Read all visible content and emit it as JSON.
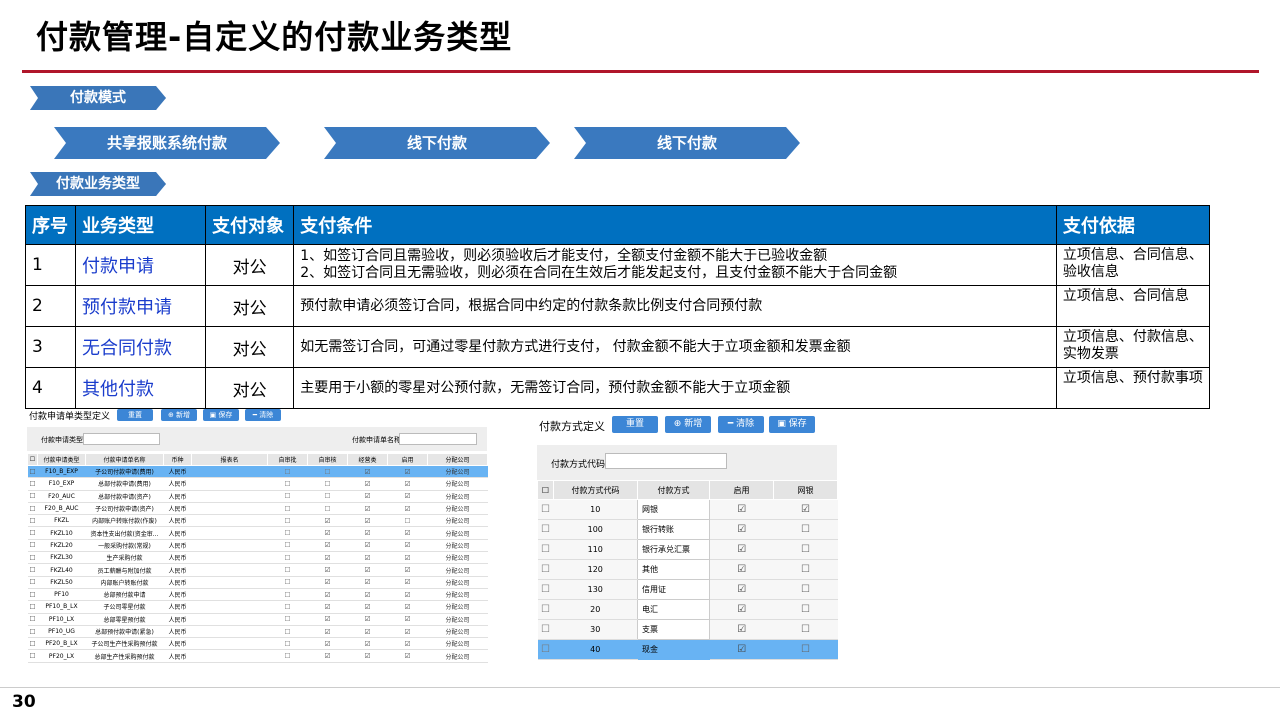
{
  "title": "付款管理-自定义的付款业务类型",
  "tags": {
    "mode": "付款模式",
    "biz_type": "付款业务类型"
  },
  "modes": [
    "共享报账系统付款",
    "线下付款",
    "线下付款"
  ],
  "table": {
    "headers": [
      "序号",
      "业务类型",
      "支付对象",
      "支付条件",
      "支付依据"
    ],
    "rows": [
      {
        "no": "1",
        "type": "付款申请",
        "target": "对公",
        "cond1": "1、如签订合同且需验收，则必须验收后才能支付，全额支付金额不能大于已验收金额",
        "cond2": "2、如签订合同且无需验收，则必须在合同在生效后才能发起支付，且支付金额不能大于合同金额",
        "basis": "立项信息、合同信息、验收信息"
      },
      {
        "no": "2",
        "type": "预付款申请",
        "target": "对公",
        "cond1": "预付款申请必须签订合同，根据合同中约定的付款条款比例支付合同预付款",
        "cond2": "",
        "basis": "立项信息、合同信息"
      },
      {
        "no": "3",
        "type": "无合同付款",
        "target": "对公",
        "cond1": "如无需签订合同，可通过零星付款方式进行支付，  付款金额不能大于立项金额和发票金额",
        "cond2": "",
        "basis": "立项信息、付款信息、实物发票"
      },
      {
        "no": "4",
        "type": "其他付款",
        "target": "对公",
        "cond1": "主要用于小额的零星对公预付款，无需签订合同，预付款金额不能大于立项金额",
        "cond2": "",
        "basis": "立项信息、预付款事项"
      }
    ]
  },
  "panel1": {
    "title": "付款申请单类型定义",
    "buttons": [
      "重置",
      "⊕ 新增",
      "▣ 保存",
      "━ 清除"
    ],
    "form": {
      "type_label": "付款申请类型:",
      "name_label": "付款申请单名称:"
    },
    "headers": [
      "付款申请类型",
      "付款申请单名称",
      "币种",
      "报表名",
      "自审批",
      "自审核",
      "经营类",
      "启用",
      "分配公司"
    ],
    "rows": [
      {
        "code": "F10_B_EXP",
        "name": "子公司付款申请(费用)",
        "cur": "人民币",
        "a": false,
        "b": false,
        "c": true,
        "d": true,
        "co": "分配公司",
        "sel": true
      },
      {
        "code": "F10_EXP",
        "name": "总部付款申请(费用)",
        "cur": "人民币",
        "a": false,
        "b": false,
        "c": true,
        "d": true,
        "co": "分配公司"
      },
      {
        "code": "F20_AUC",
        "name": "总部付款申请(资产)",
        "cur": "人民币",
        "a": false,
        "b": false,
        "c": true,
        "d": true,
        "co": "分配公司"
      },
      {
        "code": "F20_B_AUC",
        "name": "子公司付款申请(资产)",
        "cur": "人民币",
        "a": false,
        "b": false,
        "c": true,
        "d": true,
        "co": "分配公司"
      },
      {
        "code": "FKZL",
        "name": "内部账户转账付款(作废)",
        "cur": "人民币",
        "a": false,
        "b": true,
        "c": true,
        "d": false,
        "co": "分配公司"
      },
      {
        "code": "FKZL10",
        "name": "资本性支出付款(资金审...",
        "cur": "人民币",
        "a": false,
        "b": true,
        "c": true,
        "d": true,
        "co": "分配公司"
      },
      {
        "code": "FKZL20",
        "name": "一般采购付款(常规)",
        "cur": "人民币",
        "a": false,
        "b": true,
        "c": true,
        "d": true,
        "co": "分配公司"
      },
      {
        "code": "FKZL30",
        "name": "生产采购付款",
        "cur": "人民币",
        "a": false,
        "b": true,
        "c": true,
        "d": true,
        "co": "分配公司"
      },
      {
        "code": "FKZL40",
        "name": "员工薪酬与附加付款",
        "cur": "人民币",
        "a": false,
        "b": true,
        "c": true,
        "d": true,
        "co": "分配公司"
      },
      {
        "code": "FKZL50",
        "name": "内部账户转账付款",
        "cur": "人民币",
        "a": false,
        "b": true,
        "c": true,
        "d": true,
        "co": "分配公司"
      },
      {
        "code": "PF10",
        "name": "总部预付款申请",
        "cur": "人民币",
        "a": false,
        "b": true,
        "c": true,
        "d": true,
        "co": "分配公司"
      },
      {
        "code": "PF10_B_LX",
        "name": "子公司零星付款",
        "cur": "人民币",
        "a": false,
        "b": true,
        "c": true,
        "d": true,
        "co": "分配公司"
      },
      {
        "code": "PF10_LX",
        "name": "总部零星预付款",
        "cur": "人民币",
        "a": false,
        "b": true,
        "c": true,
        "d": true,
        "co": "分配公司"
      },
      {
        "code": "PF10_UG",
        "name": "总部预付款申请(紧急)",
        "cur": "人民币",
        "a": false,
        "b": true,
        "c": true,
        "d": true,
        "co": "分配公司"
      },
      {
        "code": "PF20_B_LX",
        "name": "子公司生产性采购预付款",
        "cur": "人民币",
        "a": false,
        "b": true,
        "c": true,
        "d": true,
        "co": "分配公司"
      },
      {
        "code": "PF20_LX",
        "name": "总部生产性采购预付款",
        "cur": "人民币",
        "a": false,
        "b": true,
        "c": true,
        "d": true,
        "co": "分配公司"
      }
    ]
  },
  "panel2": {
    "title": "付款方式定义",
    "buttons": [
      "重置",
      "⊕ 新增",
      "━ 清除",
      "▣ 保存"
    ],
    "form_label": "付款方式代码:",
    "headers": [
      "付款方式代码",
      "付款方式",
      "启用",
      "网银"
    ],
    "rows": [
      {
        "code": "10",
        "name": "网银",
        "enabled": true,
        "online": true
      },
      {
        "code": "100",
        "name": "银行转账",
        "enabled": true,
        "online": false
      },
      {
        "code": "110",
        "name": "银行承兑汇票",
        "enabled": true,
        "online": false
      },
      {
        "code": "120",
        "name": "其他",
        "enabled": true,
        "online": false
      },
      {
        "code": "130",
        "name": "信用证",
        "enabled": true,
        "online": false
      },
      {
        "code": "20",
        "name": "电汇",
        "enabled": true,
        "online": false
      },
      {
        "code": "30",
        "name": "支票",
        "enabled": true,
        "online": false
      },
      {
        "code": "40",
        "name": "现金",
        "enabled": true,
        "online": false,
        "sel": true
      }
    ]
  },
  "page_number": "30",
  "colors": {
    "title_line": "#b0162a",
    "header_blue": "#0070c0",
    "arrow_blue": "#3a79bf",
    "type_text": "#1a3ccc",
    "selected_row": "#68b3f3"
  }
}
